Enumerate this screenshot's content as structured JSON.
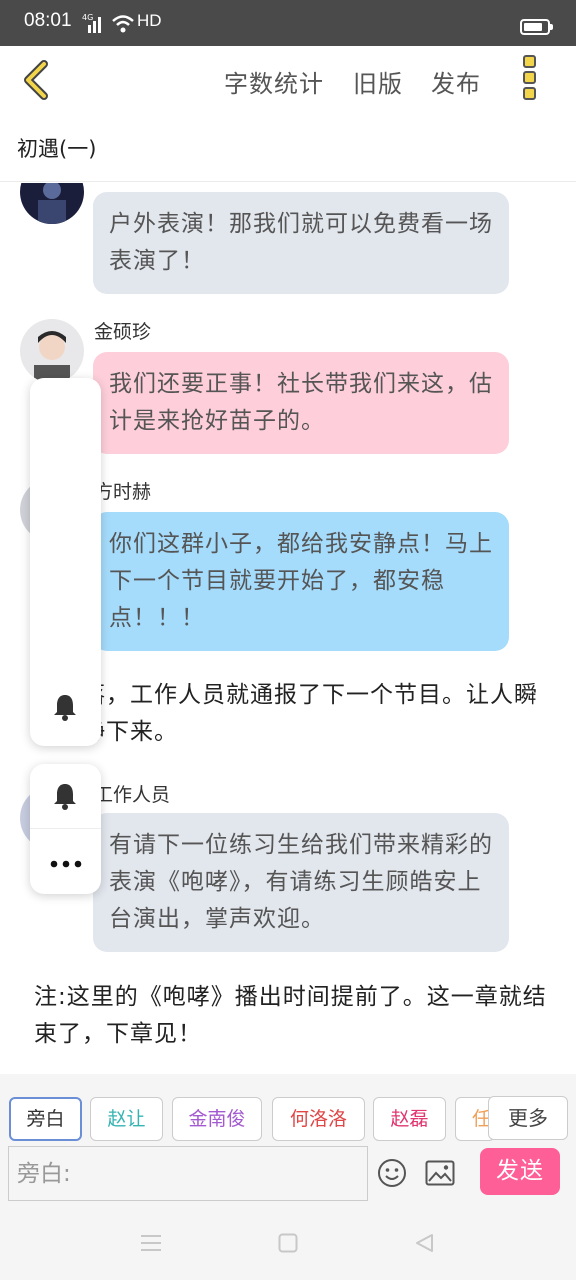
{
  "status_bar": {
    "time": "08:01",
    "network": "4G",
    "quality": "HD",
    "battery_level": 0.8
  },
  "toolbar": {
    "word_count": "字数统计",
    "old_version": "旧版",
    "publish": "发布"
  },
  "chapter": {
    "title": "初遇(一)"
  },
  "messages": [
    {
      "type": "bubble",
      "speaker": "",
      "color": "grey",
      "text": "户外表演！那我们就可以免费看一场表演了！"
    },
    {
      "type": "bubble",
      "speaker": "金硕珍",
      "color": "pink",
      "text": "我们还要正事！社长带我们来这，估计是来抢好苗子的。"
    },
    {
      "type": "bubble",
      "speaker": "方时赫",
      "color": "blue",
      "text": "你们这群小子，都给我安静点！马上下一个节目就要开始了，都安稳点！！！"
    },
    {
      "type": "narration",
      "text": "话音落，工作人员就通报了下一个节目。让人瞬间安静下来。"
    },
    {
      "type": "bubble",
      "speaker": "工作人员",
      "color": "grey",
      "text": "有请下一位练习生给我们带来精彩的表演《咆哮》，有请练习生顾皓安上台演出，掌声欢迎。"
    },
    {
      "type": "narration",
      "text": "注:这里的《咆哮》播出时间提前了。这一章就结束了，下章见！"
    }
  ],
  "bubble_colors": {
    "grey": "#e2e6ed",
    "pink": "#fecfdb",
    "blue": "#a5dbfb"
  },
  "role_chips": [
    {
      "label": "旁白",
      "color": "#333333",
      "active": true
    },
    {
      "label": "赵让",
      "color": "#35b3b3"
    },
    {
      "label": "金南俊",
      "color": "#a35ad0"
    },
    {
      "label": "何洛洛",
      "color": "#e04646"
    },
    {
      "label": "赵磊",
      "color": "#e0356f"
    },
    {
      "label": "任",
      "color": "#f0a058"
    }
  ],
  "more_label": "更多",
  "input": {
    "placeholder": "旁白:",
    "value": ""
  },
  "send_label": "发送",
  "icons": [
    "back-arrow-icon",
    "more-menu-icon",
    "bell-icon",
    "ellipsis-icon",
    "emoji-icon",
    "image-icon",
    "menu-icon",
    "home-icon",
    "back-icon"
  ],
  "accent": "#fe5f97"
}
